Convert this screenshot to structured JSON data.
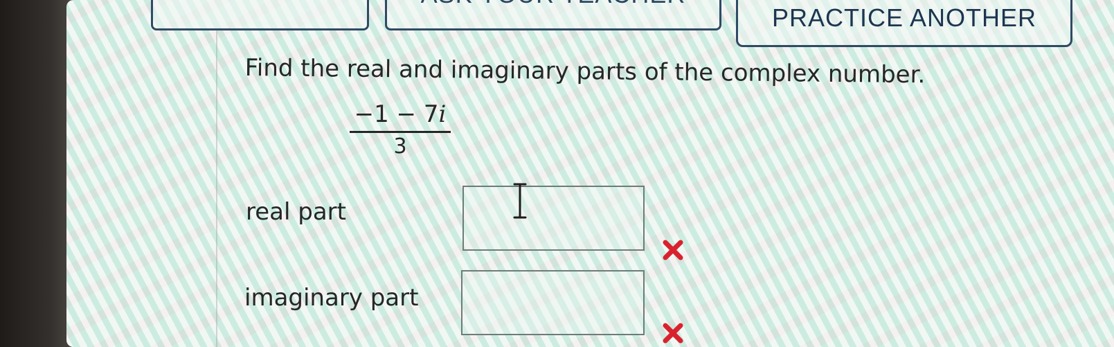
{
  "toolbar": {
    "button_1_label": "",
    "button_2_label": "ASK YOUR TEACHER",
    "button_3_label": "PRACTICE ANOTHER"
  },
  "question": {
    "prompt": "Find the real and imaginary parts of the complex number.",
    "expression": {
      "numerator_text": "−1 − 7",
      "numerator_unit": "i",
      "denominator": "3"
    }
  },
  "answers": {
    "real_label": "real part",
    "real_value": "",
    "imag_label": "imaginary part",
    "imag_value": ""
  },
  "icons": {
    "mouse_cursor": "text-cursor-icon",
    "incorrect": "red-x-icon"
  },
  "colors": {
    "button_border": "#2f4a64",
    "incorrect_mark": "#d9222e",
    "text": "#262626"
  }
}
